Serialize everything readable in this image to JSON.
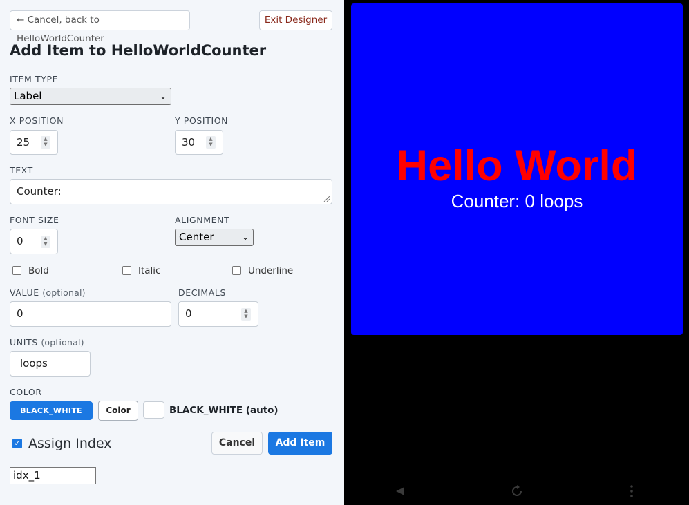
{
  "header": {
    "back_label": "← Cancel, back to HelloWorldCounter",
    "exit_label": "Exit Designer",
    "title": "Add Item to HelloWorldCounter"
  },
  "form": {
    "item_type": {
      "label": "ITEM TYPE",
      "value": "Label"
    },
    "x_position": {
      "label": "X POSITION",
      "value": "25"
    },
    "y_position": {
      "label": "Y POSITION",
      "value": "30"
    },
    "text": {
      "label": "TEXT",
      "value": "Counter:"
    },
    "font_size": {
      "label": "FONT SIZE",
      "value": "0"
    },
    "alignment": {
      "label": "ALIGNMENT",
      "value": "Center"
    },
    "bold": {
      "label": "Bold",
      "checked": false
    },
    "italic": {
      "label": "Italic",
      "checked": false
    },
    "underline": {
      "label": "Underline",
      "checked": false
    },
    "value": {
      "label": "VALUE",
      "optional": "(optional)",
      "value": "0"
    },
    "decimals": {
      "label": "DECIMALS",
      "value": "0"
    },
    "units": {
      "label": "UNITS",
      "optional": "(optional)",
      "value": "loops"
    },
    "color": {
      "label": "COLOR",
      "selected_button": "BLACK_WHITE",
      "color_button": "Color",
      "swatch": "#ffffff",
      "auto_label": "BLACK_WHITE (auto)"
    },
    "assign_index": {
      "label": "Assign Index",
      "checked": true,
      "value": "idx_1"
    },
    "cancel_label": "Cancel",
    "add_label": "Add Item"
  },
  "preview": {
    "background": "#0000ff",
    "title": "Hello World",
    "title_color": "#ff0000",
    "counter_text": "Counter: 0 loops",
    "counter_color": "#ffffff"
  },
  "nav": {
    "back_icon": "back-triangle-icon",
    "rotate_icon": "rotate-icon",
    "menu_icon": "more-vertical-icon"
  },
  "colors": {
    "primary": "#1b78e2",
    "exit_text": "#8a2a1c"
  }
}
